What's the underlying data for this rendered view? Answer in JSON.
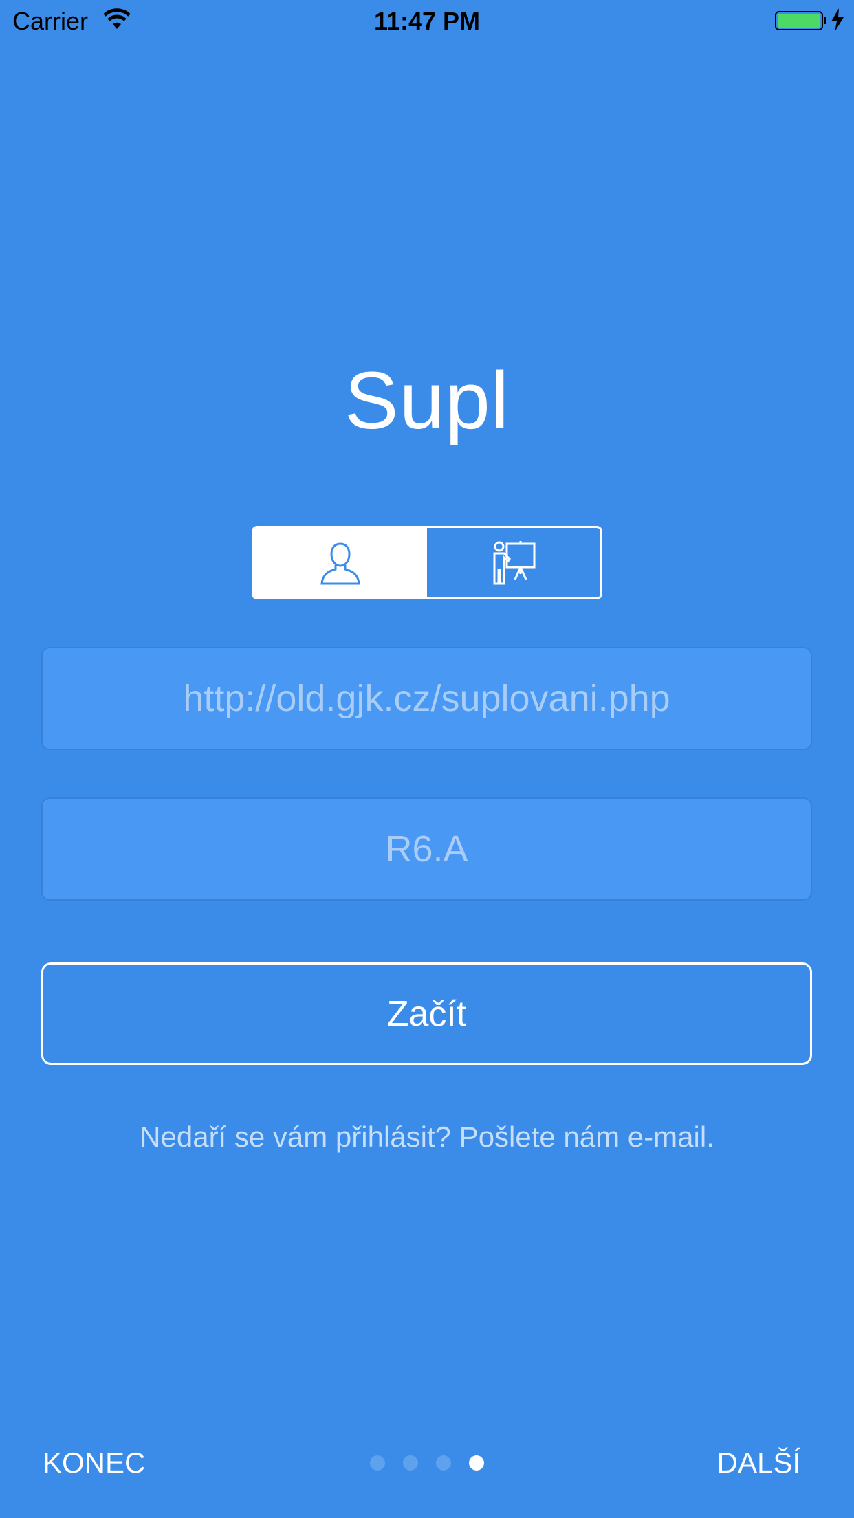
{
  "status_bar": {
    "carrier": "Carrier",
    "time": "11:47 PM",
    "wifi_icon": "wifi-icon",
    "battery_icon": "battery-icon",
    "battery_color": "#4cd964",
    "charging_icon": "bolt-icon"
  },
  "app": {
    "title": "Supl",
    "background_color": "#3b8ce9"
  },
  "role_selector": {
    "options": [
      {
        "icon": "student-icon",
        "selected": true
      },
      {
        "icon": "teacher-icon",
        "selected": false
      }
    ]
  },
  "form": {
    "url_placeholder": "http://old.gjk.cz/suplovani.php",
    "url_value": "",
    "class_placeholder": "R6.A",
    "class_value": "",
    "start_label": "Začít"
  },
  "help_text": "Nedaří se vám přihlásit? Pošlete nám e-mail.",
  "footer": {
    "skip_label": "KONEC",
    "next_label": "DALŠÍ",
    "pages_total": 4,
    "current_page": 4
  }
}
